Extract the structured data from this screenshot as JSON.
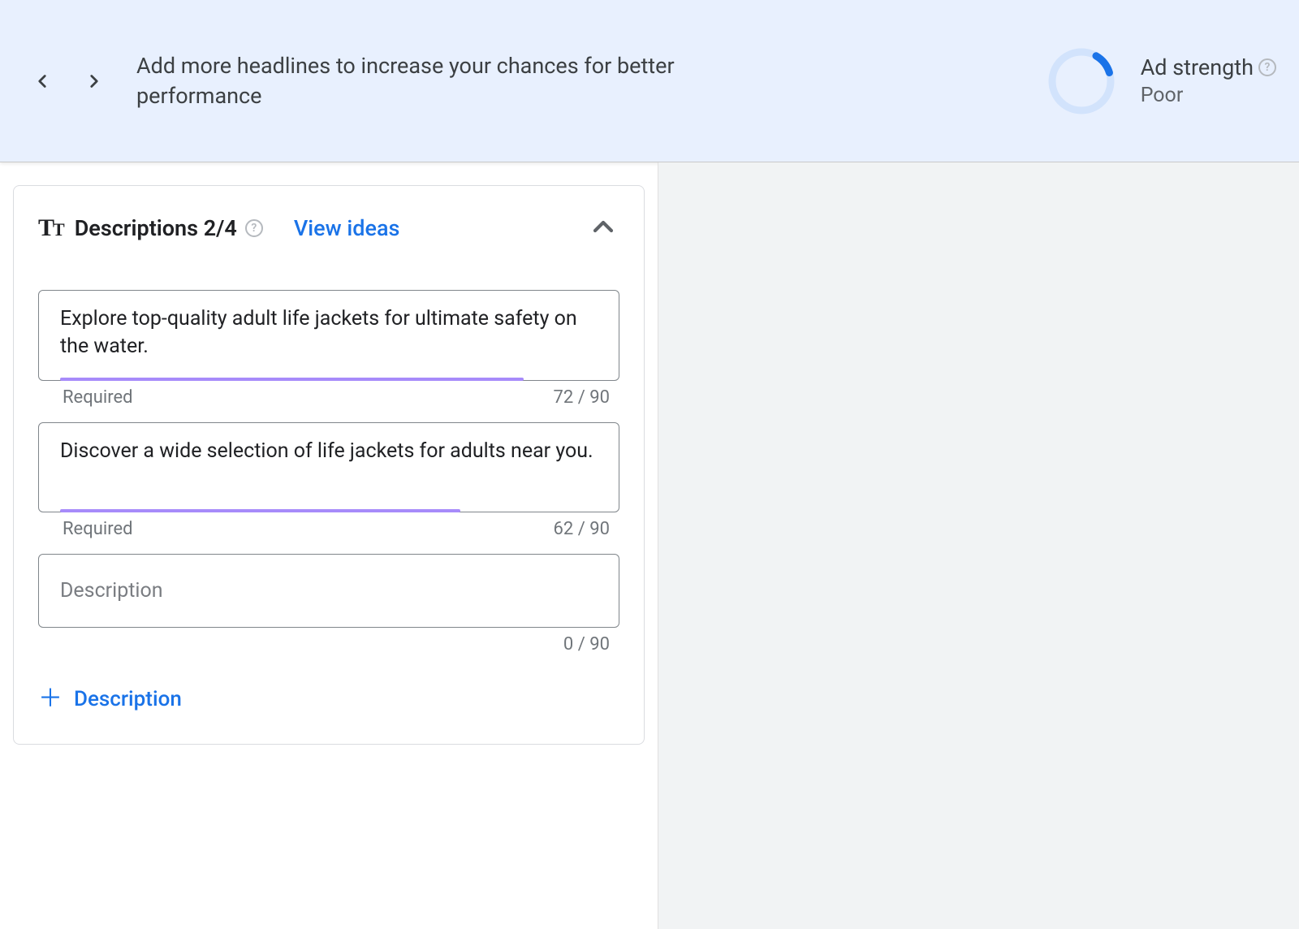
{
  "banner": {
    "message": "Add more headlines to increase your chances for better performance",
    "ad_strength_label": "Ad strength",
    "ad_strength_value": "Poor",
    "progress_percent": 12
  },
  "card": {
    "title": "Descriptions 2/4",
    "view_ideas": "View ideas",
    "add_button": "Description",
    "fields": [
      {
        "value": "Explore top-quality adult life jackets for ultimate safety on the water.",
        "required_label": "Required",
        "count": "72 / 90",
        "underline_percent": 80
      },
      {
        "value": "Discover a wide selection of life jackets for adults near you.",
        "required_label": "Required",
        "count": "62 / 90",
        "underline_percent": 69
      },
      {
        "placeholder": "Description",
        "count": "0 / 90"
      }
    ]
  }
}
